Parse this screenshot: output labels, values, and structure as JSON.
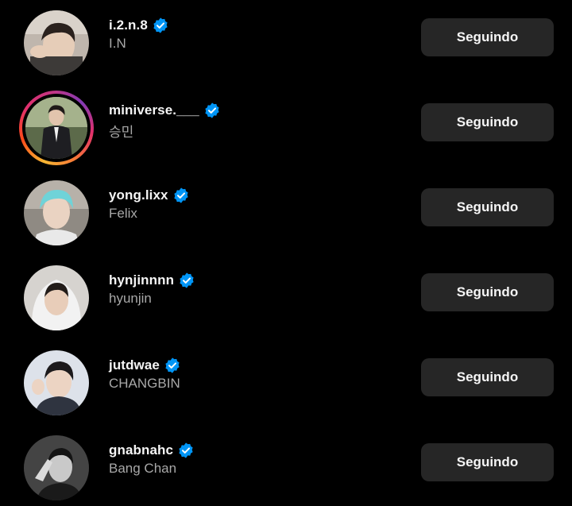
{
  "colors": {
    "background": "#000000",
    "button_bg": "#262626",
    "verified_blue": "#0095f6",
    "subtext": "#a8a8a8"
  },
  "icons": {
    "verified": "verified-badge-icon"
  },
  "following_list": [
    {
      "username": "i.2.n.8",
      "full_name": "I.N",
      "button_label": "Seguindo",
      "has_story": false,
      "verified": true
    },
    {
      "username": "miniverse.___",
      "full_name": "승민",
      "button_label": "Seguindo",
      "has_story": true,
      "verified": true
    },
    {
      "username": "yong.lixx",
      "full_name": "Felix",
      "button_label": "Seguindo",
      "has_story": false,
      "verified": true
    },
    {
      "username": "hynjinnnn",
      "full_name": "hyunjin",
      "button_label": "Seguindo",
      "has_story": false,
      "verified": true
    },
    {
      "username": "jutdwae",
      "full_name": "CHANGBIN",
      "button_label": "Seguindo",
      "has_story": false,
      "verified": true
    },
    {
      "username": "gnabnahc",
      "full_name": "Bang Chan",
      "button_label": "Seguindo",
      "has_story": false,
      "verified": true
    }
  ]
}
